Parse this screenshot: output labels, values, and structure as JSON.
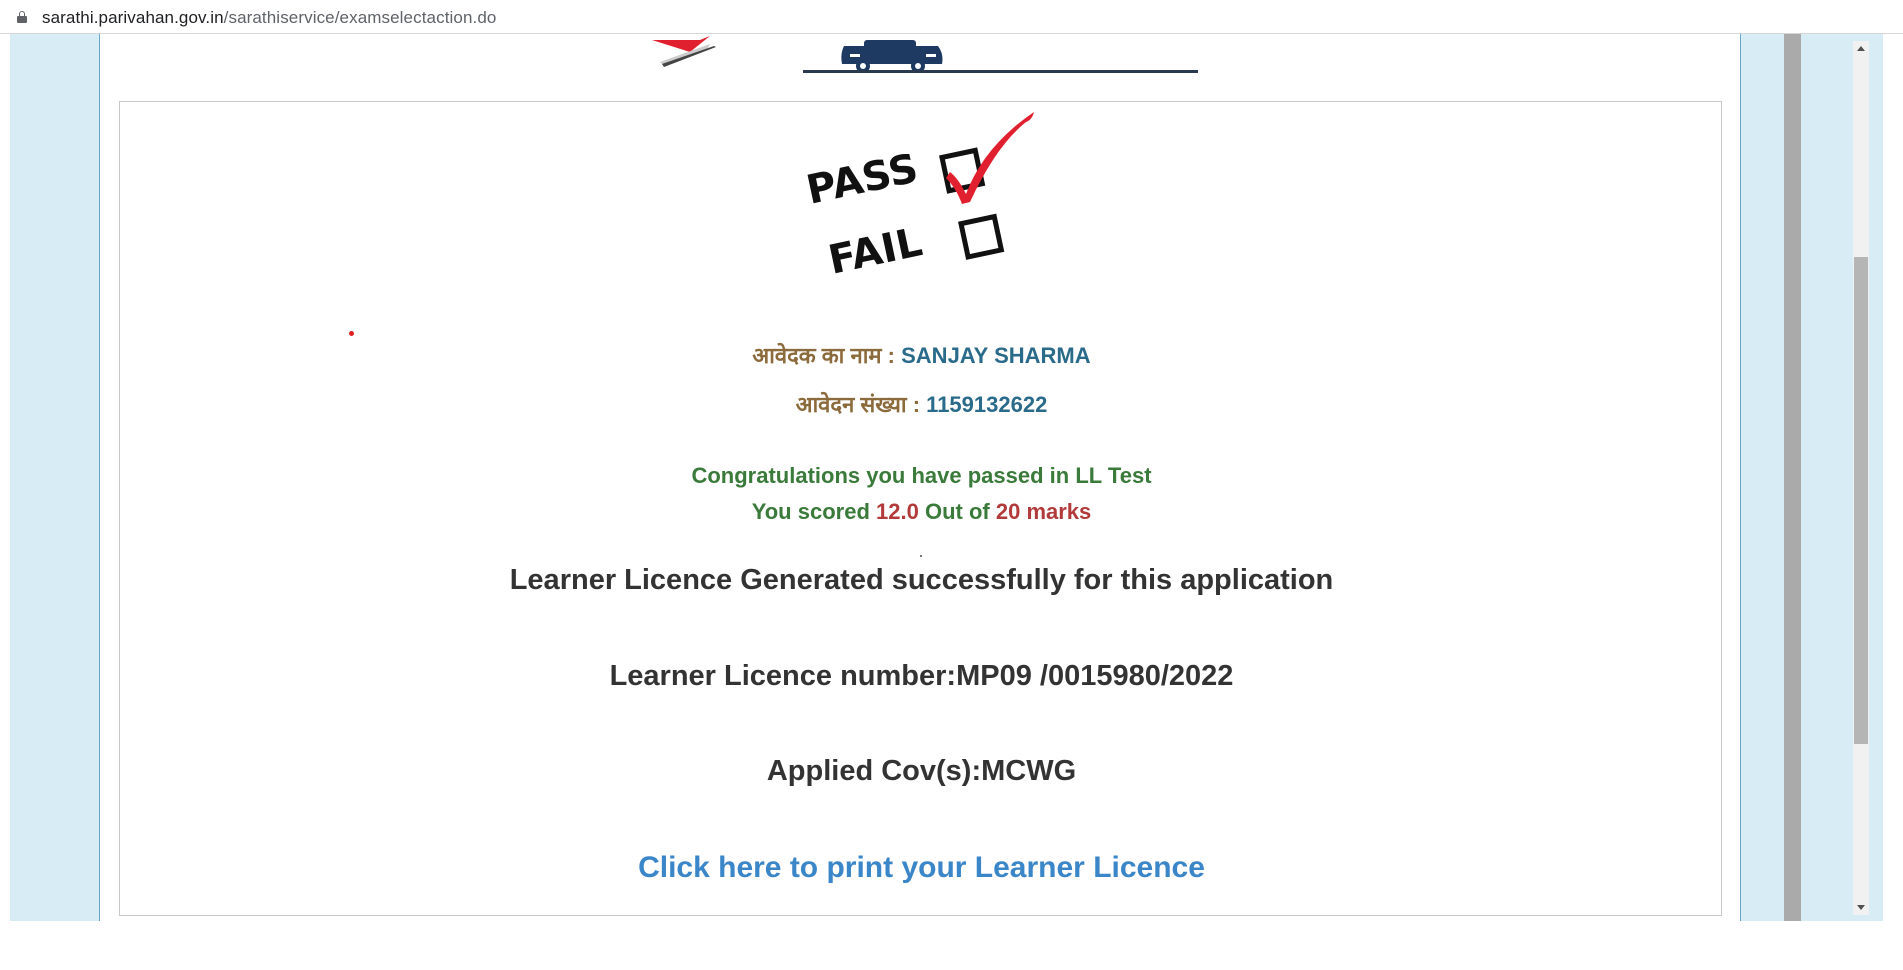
{
  "browser": {
    "url_domain": "sarathi.parivahan.gov.in",
    "url_path": "/sarathiservice/examselectaction.do"
  },
  "result": {
    "pass_label": "PASS",
    "fail_label": "FAIL",
    "applicant_name_label": "आवेदक का नाम :",
    "applicant_name": "SANJAY SHARMA",
    "application_no_label": "आवेदन संख्या :",
    "application_no": "1159132622",
    "congrats_text": "Congratulations you have passed in LL Test",
    "score_prefix": "You scored",
    "score_value": "12.0",
    "score_middle": "Out of",
    "score_total": "20 marks",
    "generated_text": "Learner Licence Generated successfully for this application",
    "ll_number_text": "Learner Licence number:MP09 /0015980/2022",
    "cov_text": "Applied Cov(s):MCWG",
    "print_link": "Click here to print your Learner Licence"
  },
  "colors": {
    "side_band": "#d8ecf6",
    "hindi_label": "#8b6a3c",
    "value_blue": "#2a6a8a",
    "success_green": "#3a7a3a",
    "score_red": "#b33a3a",
    "link_blue": "#3a86c8",
    "check_red": "#e0202e"
  },
  "icons": {
    "lock": "lock-icon",
    "check": "red-check-icon"
  }
}
